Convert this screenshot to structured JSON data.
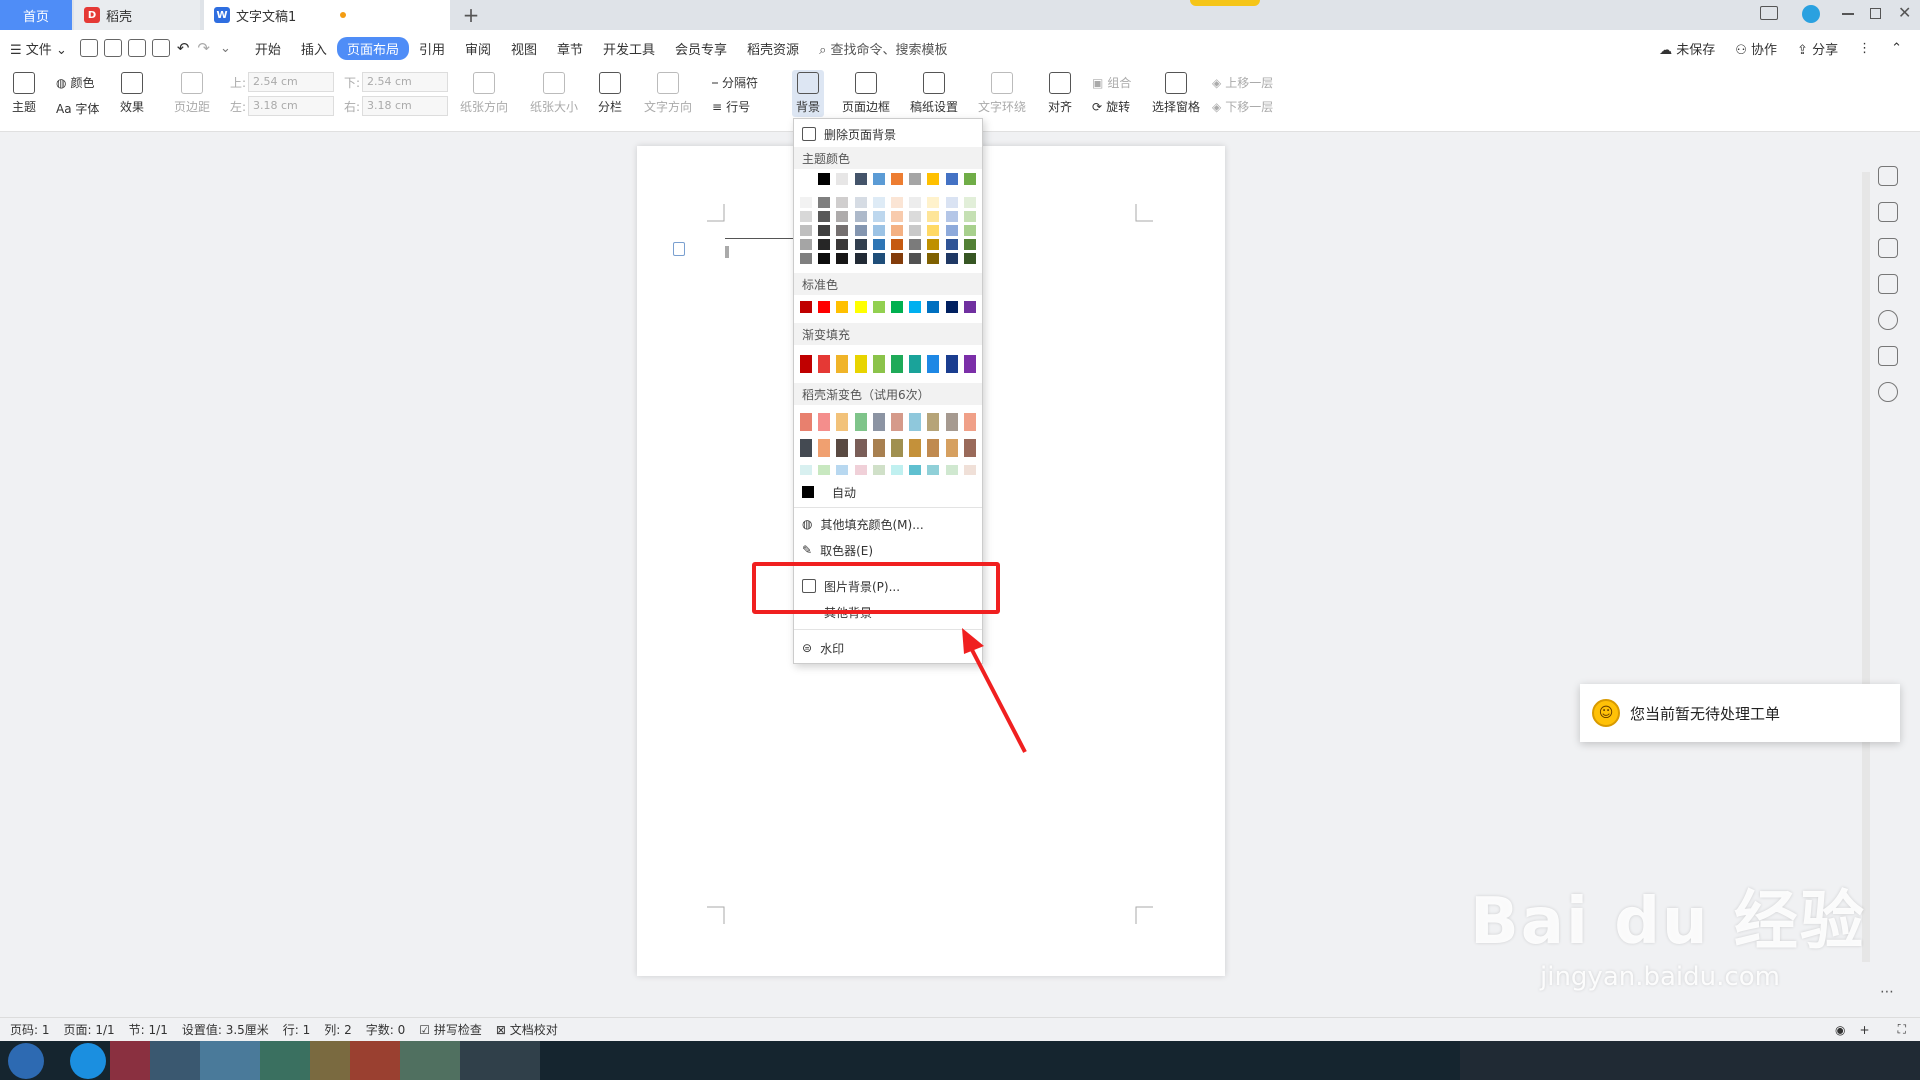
{
  "tabs": {
    "home": "首页",
    "daoke": "稻壳",
    "doc": "文字文稿1",
    "add": "+"
  },
  "menu": {
    "file": "文件",
    "items": [
      "开始",
      "插入",
      "页面布局",
      "引用",
      "审阅",
      "视图",
      "章节",
      "开发工具",
      "会员专享",
      "稻壳资源"
    ],
    "active": "页面布局",
    "search_placeholder": "查找命令、搜索模板",
    "unsaved": "未保存",
    "collab": "协作",
    "share": "分享"
  },
  "ribbon": {
    "theme": "主题",
    "color": "颜色",
    "font": "Aa 字体",
    "effect": "效果",
    "margins": "页边距",
    "top_label": "上:",
    "top_value": "2.54 cm",
    "bottom_label": "下:",
    "bottom_value": "2.54 cm",
    "left_label": "左:",
    "left_value": "3.18 cm",
    "right_label": "右:",
    "right_value": "3.18 cm",
    "orientation": "纸张方向",
    "size": "纸张大小",
    "columns": "分栏",
    "text_direction": "文字方向",
    "separator": "分隔符",
    "line_number": "行号",
    "background": "背景",
    "page_border": "页面边框",
    "draft_settings": "稿纸设置",
    "text_wrap": "文字环绕",
    "align": "对齐",
    "group": "组合",
    "rotate": "旋转",
    "select_pane": "选择窗格",
    "bring_forward": "上移一层",
    "send_backward": "下移一层"
  },
  "dropdown": {
    "remove_bg": "删除页面背景",
    "theme_colors": "主题颜色",
    "standard_colors": "标准色",
    "gradient_fill": "渐变填充",
    "daoke_gradient": "稻壳渐变色（试用6次）",
    "auto": "自动",
    "more_colors": "其他填充颜色(M)...",
    "eyedropper": "取色器(E)",
    "picture_bg": "图片背景(P)...",
    "other_bg": "其他背景",
    "watermark": "水印",
    "theme_top": [
      "#ffffff",
      "#000000",
      "#e7e6e6",
      "#44546a",
      "#5b9bd5",
      "#ed7d31",
      "#a5a5a5",
      "#ffc000",
      "#4472c4",
      "#70ad47"
    ],
    "theme_shades": [
      [
        "#f2f2f2",
        "#7f7f7f",
        "#d0cece",
        "#d6dce4",
        "#deebf6",
        "#fbe5d5",
        "#ededed",
        "#fff2cc",
        "#dae3f3",
        "#e2efd9"
      ],
      [
        "#d8d8d8",
        "#595959",
        "#aeabab",
        "#adb9ca",
        "#bdd7ee",
        "#f8cbad",
        "#dbdbdb",
        "#fee599",
        "#b4c6e7",
        "#c5e0b3"
      ],
      [
        "#bfbfbf",
        "#3f3f3f",
        "#757070",
        "#8496b0",
        "#9cc3e5",
        "#f4b183",
        "#c9c9c9",
        "#ffd965",
        "#8eaadb",
        "#a8d08d"
      ],
      [
        "#a5a5a5",
        "#262626",
        "#3a3838",
        "#323f4f",
        "#2e75b5",
        "#c55a11",
        "#7b7b7b",
        "#bf9000",
        "#2f5496",
        "#538135"
      ],
      [
        "#7f7f7f",
        "#0c0c0c",
        "#171616",
        "#222a35",
        "#1f4e79",
        "#833c0b",
        "#525252",
        "#7f6000",
        "#1f3864",
        "#375623"
      ]
    ],
    "standard": [
      "#c00000",
      "#ff0000",
      "#ffc000",
      "#ffff00",
      "#92d050",
      "#00b050",
      "#00b0f0",
      "#0070c0",
      "#002060",
      "#7030a0"
    ],
    "gradients": [
      "#c00000",
      "#e53935",
      "#f0b429",
      "#e8d400",
      "#8bc34a",
      "#1faa59",
      "#1aa39a",
      "#1e88e5",
      "#1a3d8f",
      "#7b2fa8"
    ],
    "daoke_row1": [
      "#e8806e",
      "#f48e8c",
      "#f2c27a",
      "#7fc48a",
      "#8c94a3",
      "#d59a8a",
      "#8fc8dc",
      "#b6a478",
      "#a69a90",
      "#f0a088"
    ],
    "daoke_row2": [
      "#444a52",
      "#f0a070",
      "#5a4a42",
      "#7a5e58",
      "#a88050",
      "#a09050",
      "#c4913a",
      "#c08a50",
      "#d6a060",
      "#9a6a5a"
    ],
    "daoke_row3": [
      "#d8f0f0",
      "#c8e8c0",
      "#b8d8f0",
      "#f0d0d8",
      "#d0e0c8",
      "#c0f0f0",
      "#60c0d0",
      "#90d0d8",
      "#d0e8d0",
      "#f0e0d8"
    ]
  },
  "status": {
    "page": "页码: 1",
    "pages": "页面: 1/1",
    "section": "节: 1/1",
    "setting": "设置值: 3.5厘米",
    "row": "行: 1",
    "col": "列: 2",
    "words": "字数: 0",
    "spell": "拼写检查",
    "proof": "文档校对"
  },
  "toast": {
    "text": "您当前暂无待处理工单"
  },
  "watermark": {
    "brand": "Bai du 经验",
    "url": "jingyan.baidu.com"
  },
  "colors": {
    "accent": "#4f8df7",
    "highlight": "#f02020",
    "taskbar": "#15252f"
  }
}
